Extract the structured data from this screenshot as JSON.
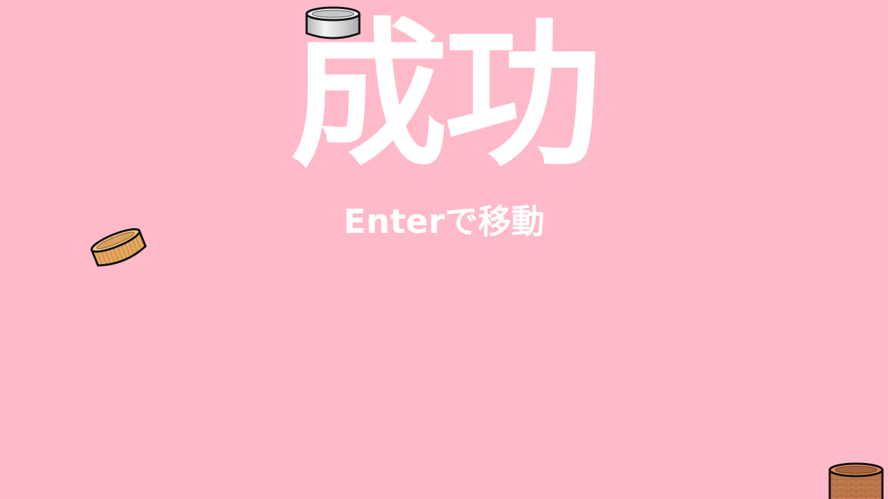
{
  "scene": {
    "background": "#ffbaca",
    "title_color": "#ffffff",
    "title": "成功",
    "hint": "Enterで移動"
  },
  "pots": [
    {
      "name": "metal-pot",
      "material": "metal",
      "colors": {
        "side": "#d2d2d2",
        "rim": "#f0f0f0",
        "inner": "#c4c4c4"
      }
    },
    {
      "name": "wood-pot",
      "material": "wood",
      "colors": {
        "side": "#dd9f5a",
        "rim": "#f2c487",
        "inner": "#c98947"
      }
    },
    {
      "name": "brick-pot",
      "material": "brick",
      "colors": {
        "side": "#c0774c",
        "rim": "#d4895d",
        "inner": "#a5603a"
      }
    }
  ]
}
